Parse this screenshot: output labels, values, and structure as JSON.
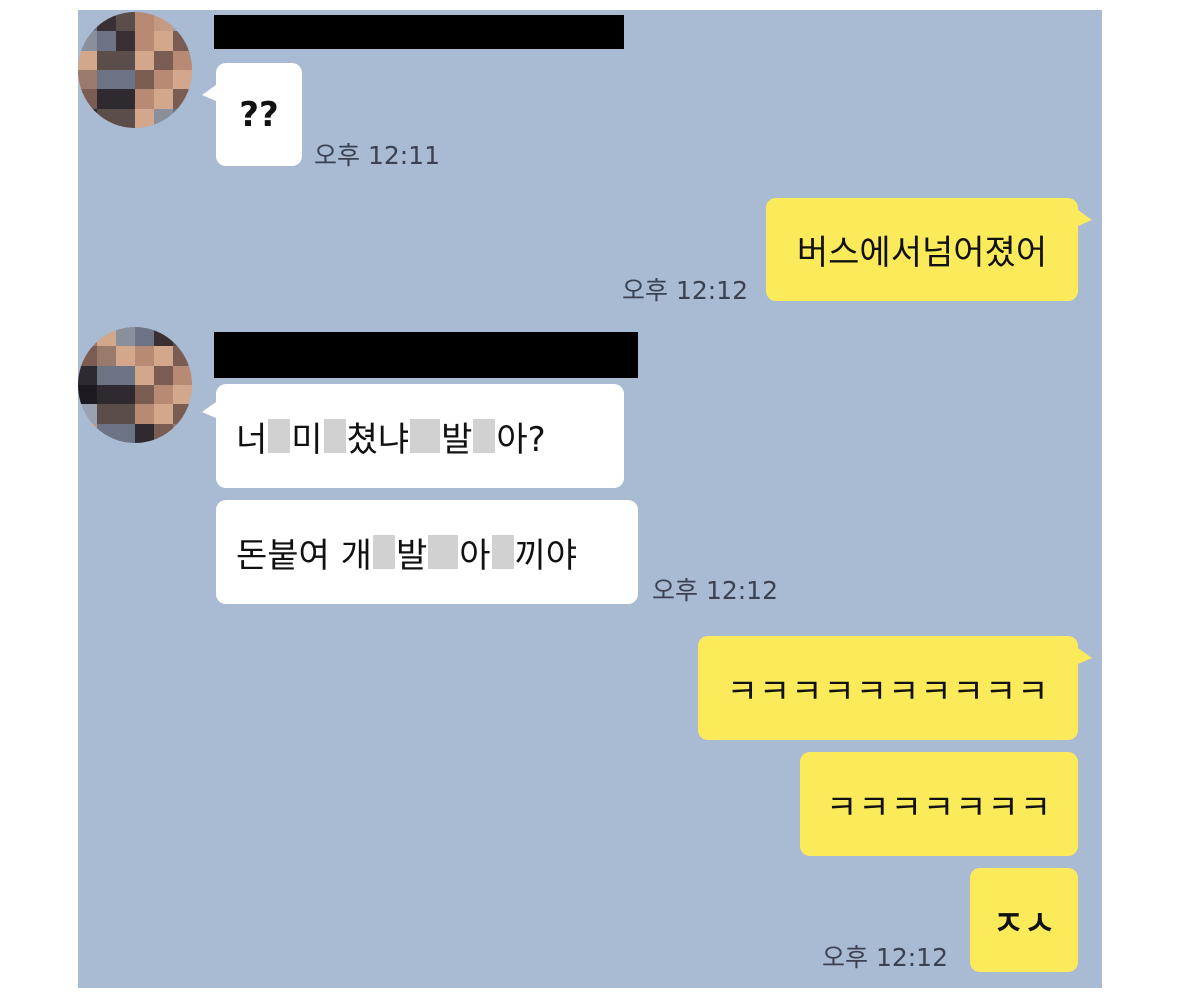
{
  "messages": [
    {
      "direction": "incoming",
      "text": "??",
      "time": "오후 12:11"
    },
    {
      "direction": "outgoing",
      "text": "버스에서넘어졌어",
      "time": "오후 12:12"
    },
    {
      "direction": "incoming",
      "parts": [
        "너",
        "미",
        "쳤냐",
        "발",
        "아?"
      ]
    },
    {
      "direction": "incoming",
      "parts": [
        "돈붙여 개",
        "발",
        "아",
        "끼야"
      ],
      "time": "오후 12:12"
    },
    {
      "direction": "outgoing",
      "text": "ㅋㅋㅋㅋㅋㅋㅋㅋㅋㅋ"
    },
    {
      "direction": "outgoing",
      "text": "ㅋㅋㅋㅋㅋㅋㅋ"
    },
    {
      "direction": "outgoing",
      "text": "ㅈㅅ",
      "time": "오후 12:12"
    }
  ],
  "colors": {
    "chat_background": "#a9bad3",
    "incoming_bubble": "#ffffff",
    "outgoing_bubble": "#fbeb5b",
    "redaction_bar": "#000000"
  }
}
